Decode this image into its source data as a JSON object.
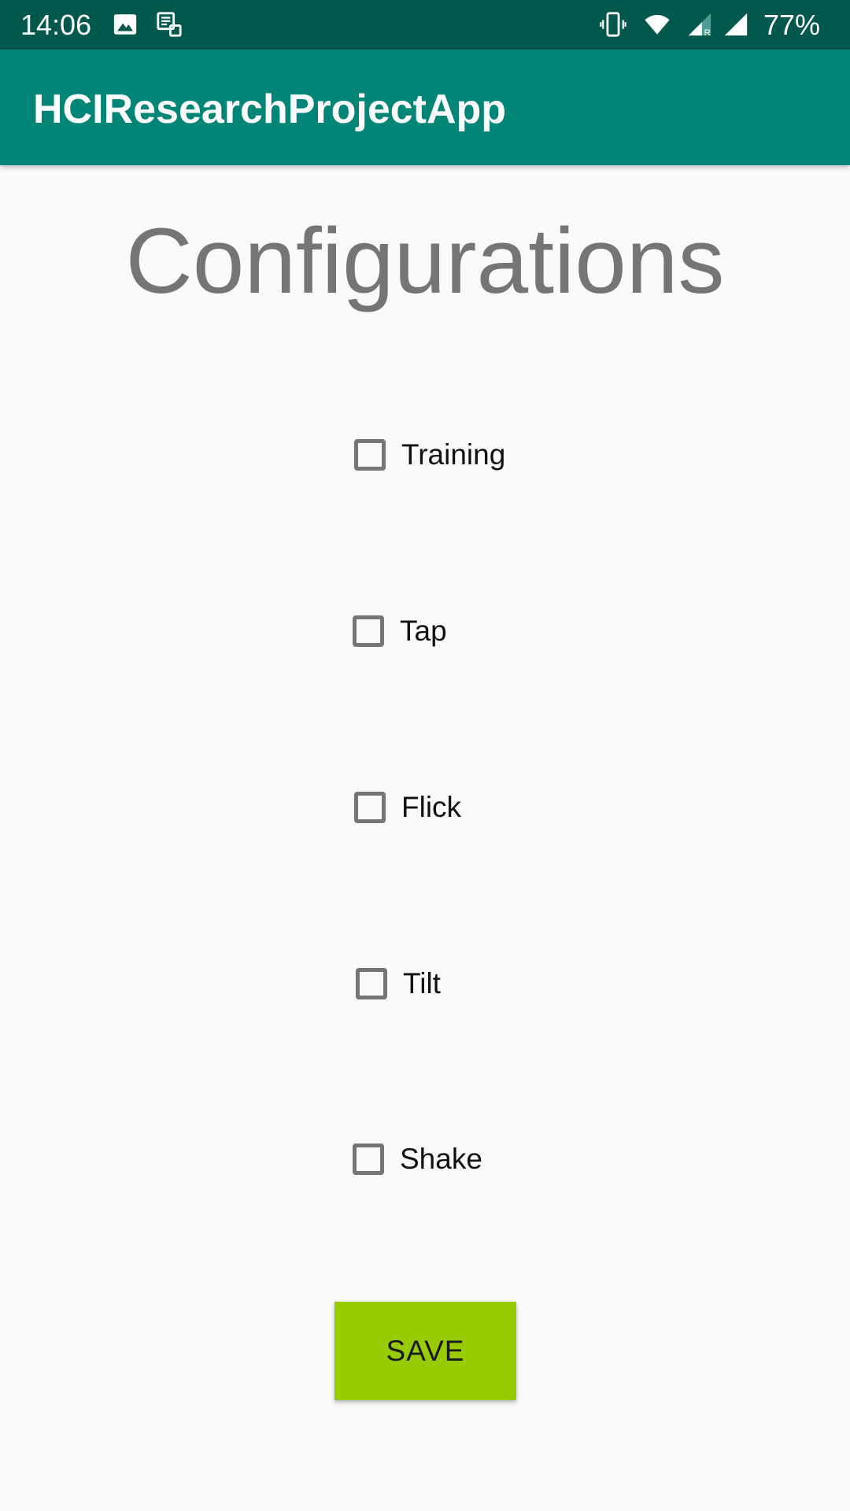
{
  "status_bar": {
    "time": "14:06",
    "battery": "77%",
    "icons": [
      "image-icon",
      "notification-icon",
      "vibrate-icon",
      "wifi-icon",
      "signal-roaming-icon",
      "signal-icon"
    ]
  },
  "app_bar": {
    "title": "HCIResearchProjectApp",
    "color": "#008577"
  },
  "main": {
    "title": "Configurations",
    "options": [
      {
        "label": "Training",
        "checked": false
      },
      {
        "label": "Tap",
        "checked": false
      },
      {
        "label": "Flick",
        "checked": false
      },
      {
        "label": "Tilt",
        "checked": false
      },
      {
        "label": "Shake",
        "checked": false
      }
    ],
    "save_label": "SAVE",
    "save_color": "#99cc00"
  }
}
